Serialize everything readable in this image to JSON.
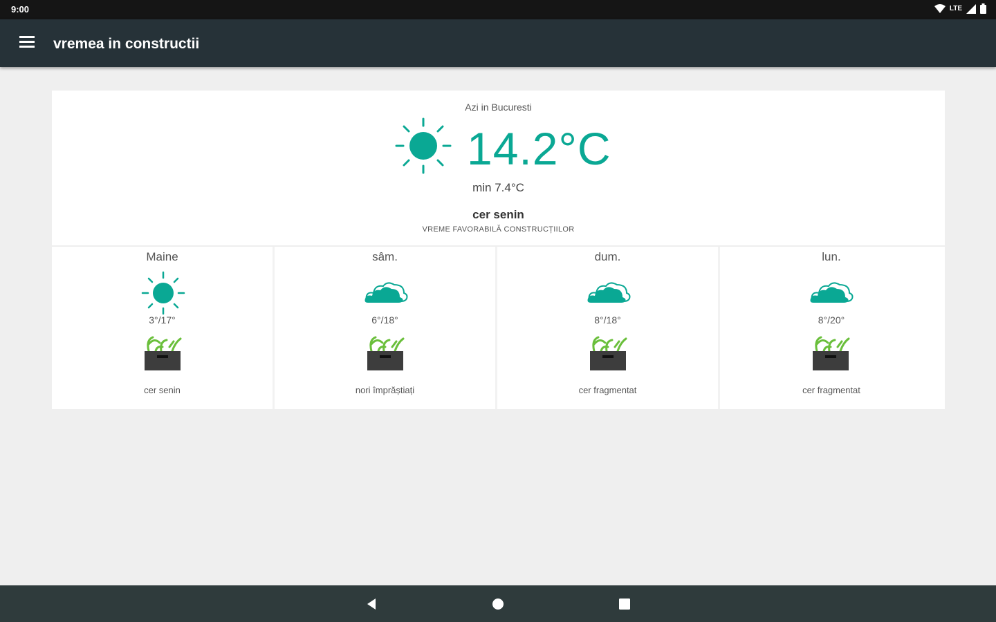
{
  "status_bar": {
    "time": "9:00",
    "network": "LTE"
  },
  "app_bar": {
    "title": "vremea in constructii",
    "menu_icon": "hamburger-menu-icon"
  },
  "today": {
    "location": "Azi in Bucuresti",
    "icon": "sun-icon",
    "temperature": "14.2°C",
    "min_temp": "min 7.4°C",
    "condition": "cer senin",
    "verdict": "VREME FAVORABILĂ CONSTRUCȚIILOR"
  },
  "forecast": [
    {
      "day": "Maine",
      "icon": "sun-icon",
      "range": "3°/17°",
      "plant_icon": "plant-box-icon",
      "description": "cer senin"
    },
    {
      "day": "sâm.",
      "icon": "cloud-icon",
      "range": "6°/18°",
      "plant_icon": "plant-box-icon",
      "description": "nori împrăștiați"
    },
    {
      "day": "dum.",
      "icon": "cloud-icon",
      "range": "8°/18°",
      "plant_icon": "plant-box-icon",
      "description": "cer fragmentat"
    },
    {
      "day": "lun.",
      "icon": "cloud-icon",
      "range": "8°/20°",
      "plant_icon": "plant-box-icon",
      "description": "cer fragmentat"
    }
  ],
  "nav_bar": {
    "back": "back-icon",
    "home": "home-icon",
    "recents": "recents-icon"
  },
  "colors": {
    "accent": "#0aa894",
    "app_bar": "#263238",
    "nav_bar": "#2f3b3c",
    "plant": "#6abf3b"
  }
}
